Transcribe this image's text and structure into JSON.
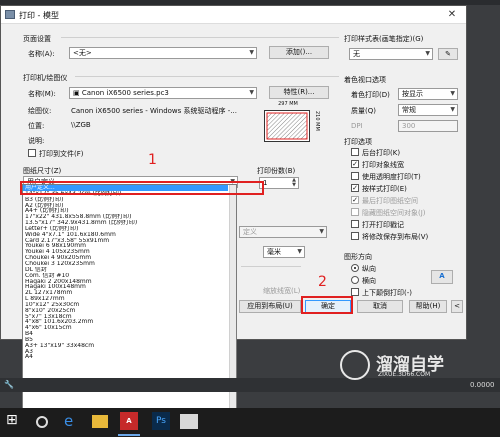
{
  "dialog": {
    "title": "打印 - 模型",
    "close_glyph": "✕",
    "page_setup": {
      "group_label": "页面设置",
      "name_label": "名称(A):",
      "name_value": "<无>",
      "add_button": "添加()..."
    },
    "printer": {
      "group_label": "打印机/绘图仪",
      "name_label": "名称(M):",
      "name_value": "Canon iX6500 series.pc3",
      "properties_button": "特性(R)...",
      "plotter_label": "绘图仪:",
      "plotter_value": "Canon iX6500 series - Windows 系统驱动程序 -...",
      "location_label": "位置:",
      "location_value": "\\\\ZGB",
      "description_label": "说明:",
      "print_to_file_label": "打印到文件(F)",
      "preview_width": "297 MM",
      "preview_height": "210 MM"
    },
    "paper_size": {
      "group_label": "图纸尺寸(Z)",
      "selected": "用户定义",
      "list_top": "用户定义...",
      "options": [
        "用户定义...",
        "14\"x17\"  35.6x43.2cm (比例打印)",
        "B3 (比例打印)",
        "A2 (比例打印)",
        "A4+ (比例打印)",
        "17\"x22\" 431.8x558.8mm (比例打印)",
        "13.5\"x17\" 342.9x431.8mm (比例打印)",
        "Letter+ (比例打印)",
        "Wide 4\"x7.1\" 101.6x180.6mm",
        "Card 2.17\"x3.58\" 55x91mm",
        "Youkei 6 98x190mm",
        "Youkei 4 105x235mm",
        "Choukei 4 90x205mm",
        "Choukei 3 120x235mm",
        "DL 信封",
        "Com. 信封 #10",
        "Hagaki 2 200x148mm",
        "Hagaki 100x148mm",
        "2L 127x178mm",
        "L 89x127mm",
        "10\"x12\" 25x30cm",
        "8\"x10\" 20x25cm",
        "5\"x7\" 13x18cm",
        "4\"x8\" 101.6x203.2mm",
        "4\"x6\" 10x15cm",
        "B4",
        "B5",
        "A3+ 13\"x19\" 33x48cm",
        "A3",
        "A4"
      ]
    },
    "copies": {
      "label": "打印份数(B)",
      "value": "1"
    },
    "scale": {
      "unit_value": "毫米",
      "unit_partial": "定义",
      "lineweight_label": "缩放线宽(L)"
    },
    "apply_button": "应用到布局(U)",
    "ok_button": "确定",
    "cancel_button": "取消",
    "help_button": "帮助(H)",
    "more_glyph": "<",
    "plot_style": {
      "group_label": "打印样式表(画笔指定)(G)",
      "value": "无"
    },
    "shaded_viewport": {
      "group_label": "着色视口选项",
      "shade_label": "着色打印(D)",
      "shade_value": "按显示",
      "quality_label": "质量(Q)",
      "quality_value": "常规",
      "dpi_label": "DPI",
      "dpi_value": "300"
    },
    "plot_options": {
      "group_label": "打印选项",
      "items": [
        {
          "label": "后台打印(K)",
          "checked": false,
          "enabled": true
        },
        {
          "label": "打印对象线宽",
          "checked": true,
          "enabled": true
        },
        {
          "label": "使用透明度打印(T)",
          "checked": false,
          "enabled": true
        },
        {
          "label": "按样式打印(E)",
          "checked": true,
          "enabled": true
        },
        {
          "label": "最后打印图纸空间",
          "checked": true,
          "enabled": false
        },
        {
          "label": "隐藏图纸空间对象(J)",
          "checked": false,
          "enabled": false
        },
        {
          "label": "打开打印戳记",
          "checked": false,
          "enabled": true
        },
        {
          "label": "将修改保存到布局(V)",
          "checked": false,
          "enabled": true
        }
      ]
    },
    "orientation": {
      "group_label": "图形方向",
      "portrait": "纵向",
      "landscape": "横向",
      "upside_down": "上下颠倒打印(-)",
      "rotate_glyph": "A"
    }
  },
  "annotations": {
    "step1": "1",
    "step2": "2"
  },
  "statusbar": {
    "coord": "0.0000"
  },
  "watermark": {
    "brand": "溜溜自学",
    "url": "ZIXUE.3D66.COM"
  },
  "colors": {
    "highlight": "#3399ff",
    "annotation_red": "#e02020",
    "taskbar": "#1c1c1c"
  }
}
